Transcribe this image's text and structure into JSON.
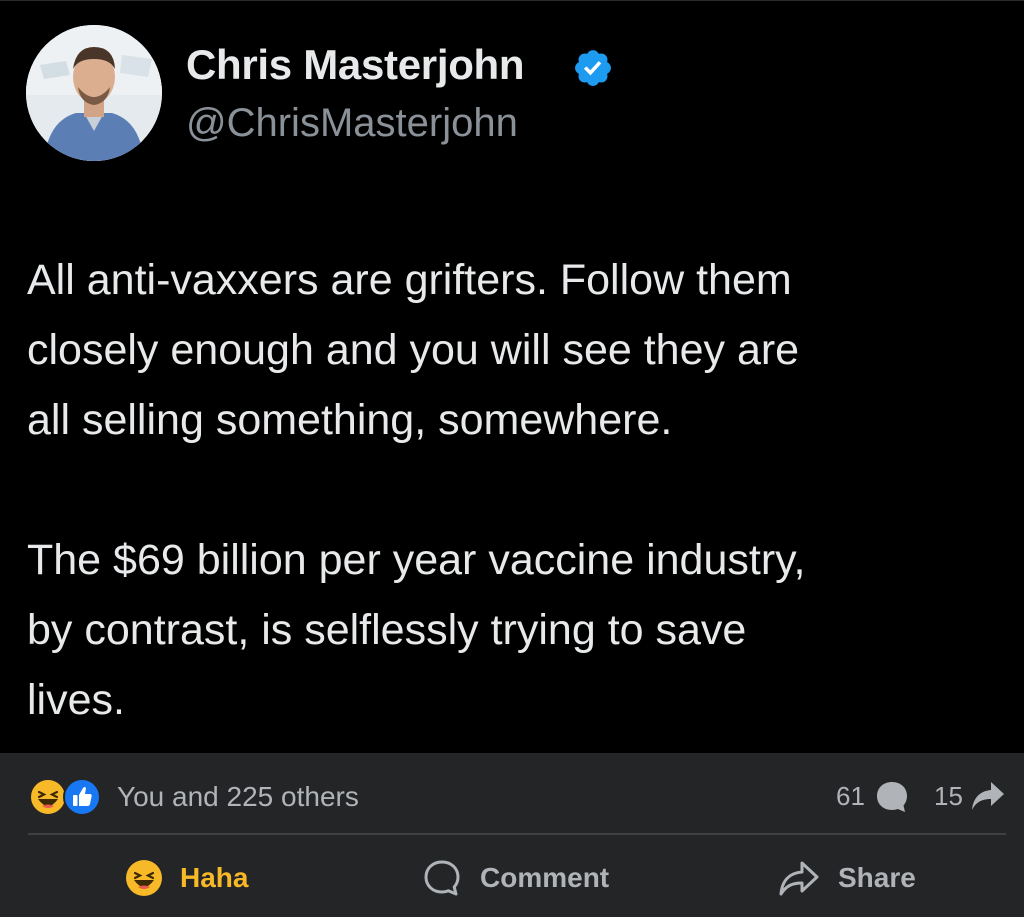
{
  "tweet": {
    "display_name": "Chris Masterjohn",
    "handle": "@ChrisMasterjohn",
    "text": "All anti-vaxxers are grifters. Follow them\nclosely enough and you will see they are\nall selling something, somewhere.\n\nThe $69 billion per year vaccine industry,\nby contrast, is selflessly trying to save\nlives.",
    "verified_color": "#1d9bf0"
  },
  "footer": {
    "reactions": [
      "haha-emoji",
      "like-icon"
    ],
    "reactors_text": "You and 225 others",
    "comment_count": "61",
    "share_count": "15",
    "actions": {
      "haha": "Haha",
      "comment": "Comment",
      "share": "Share"
    },
    "colors": {
      "bar_bg": "#242526",
      "haha_accent": "#f7b928",
      "like_blue": "#1877f2",
      "muted_text": "#b0b3b8"
    }
  }
}
